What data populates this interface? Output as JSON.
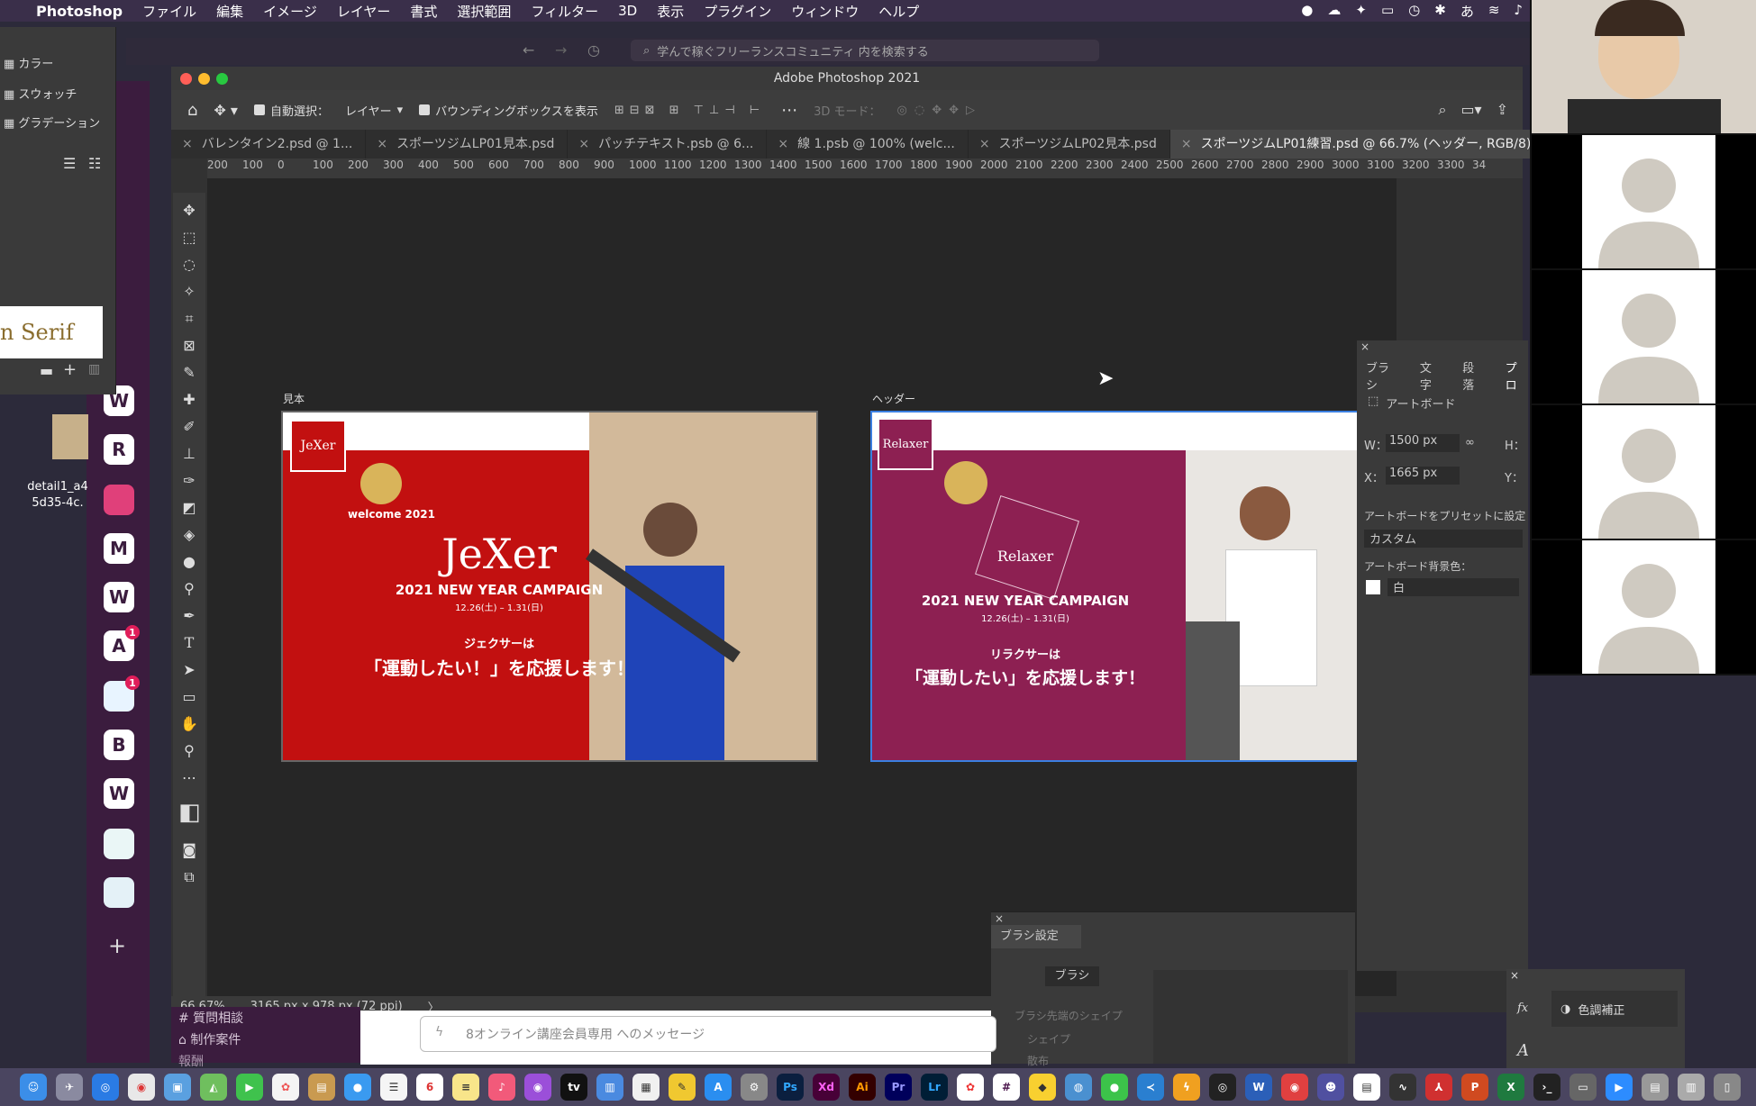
{
  "menubar": {
    "app": "Photoshop",
    "items": [
      "ファイル",
      "編集",
      "イメージ",
      "レイヤー",
      "書式",
      "選択範囲",
      "フィルター",
      "3D",
      "表示",
      "プラグイン",
      "ウィンドウ",
      "ヘルプ"
    ]
  },
  "search": {
    "placeholder": "学んで稼ぐフリーランスコミュニティ 内を検索する"
  },
  "swatches": {
    "items": [
      "カラー",
      "スウォッチ",
      "グラデーション"
    ],
    "font_preview": "n Serif"
  },
  "desktop": {
    "file_label_1": "detail1_a4",
    "file_label_2": "5d35-4c."
  },
  "slack": {
    "workspaces": [
      {
        "letter": "W",
        "badge": ""
      },
      {
        "letter": "R",
        "badge": ""
      },
      {
        "letter": "",
        "badge": ""
      },
      {
        "letter": "M",
        "badge": ""
      },
      {
        "letter": "W",
        "badge": ""
      },
      {
        "letter": "A",
        "badge": "1"
      },
      {
        "letter": "",
        "badge": "1"
      },
      {
        "letter": "B",
        "badge": ""
      },
      {
        "letter": "W",
        "badge": ""
      },
      {
        "letter": "",
        "badge": ""
      },
      {
        "letter": "",
        "badge": ""
      }
    ],
    "add": "+",
    "channel_1": "# 質問相談",
    "channel_2": "制作案件",
    "channel_3": "報酬",
    "message_placeholder": "8オンライン講座会員専用 へのメッセージ"
  },
  "photoshop": {
    "title": "Adobe Photoshop 2021",
    "options": {
      "auto_select": "自動選択：",
      "layer": "レイヤー",
      "bounding_box": "バウンディングボックスを表示",
      "mode_3d": "3D モード："
    },
    "tabs": [
      "バレンタイン2.psd @ 1...",
      "スポーツジムLP01見本.psd",
      "パッチテキスト.psb @ 6...",
      "線 1.psb @ 100% (welc...",
      "スポーツジムLP02見本.psd",
      "スポーツジムLP01練習.psd @ 66.7% (ヘッダー, RGB/8)"
    ],
    "ruler": [
      "200",
      "100",
      "0",
      "100",
      "200",
      "300",
      "400",
      "500",
      "600",
      "700",
      "800",
      "900",
      "1000",
      "1100",
      "1200",
      "1300",
      "1400",
      "1500",
      "1600",
      "1700",
      "1800",
      "1900",
      "2000",
      "2100",
      "2200",
      "2300",
      "2400",
      "2500",
      "2600",
      "2700",
      "2800",
      "2900",
      "3000",
      "3100",
      "3200",
      "3300",
      "34"
    ],
    "status": {
      "zoom": "66.67%",
      "doc": "3165 px x 978 px (72 ppi)",
      "arrow": "〉"
    },
    "artboard_1": {
      "label": "見本",
      "logo": "JeXer",
      "badge_text": "welcome 2021",
      "brand": "JeXer",
      "campaign": "2021 NEW YEAR CAMPAIGN",
      "dates": "12.26(土) – 1.31(日)",
      "subtitle": "ジェクサーは",
      "headline": "「運動したい！」を応援します！"
    },
    "artboard_2": {
      "label": "ヘッダー",
      "logo": "Relaxer",
      "brand": "Relaxer",
      "campaign": "2021 NEW YEAR CAMPAIGN",
      "dates": "12.26(土) – 1.31(日)",
      "subtitle": "リラクサーは",
      "headline": "「運動したい」を応援します！"
    },
    "properties": {
      "tabs": [
        "ブラシ",
        "文字",
        "段落",
        "プロ"
      ],
      "type": "アートボード",
      "w_label": "W：",
      "w_value": "1500 px",
      "h_label": "H：",
      "x_label": "X：",
      "x_value": "1665 px",
      "y_label": "Y：",
      "preset_label": "アートボードをプリセットに設定",
      "preset_value": "カスタム",
      "bg_label": "アートボード背景色：",
      "bg_value": "白"
    },
    "brush_panel": {
      "title": "ブラシ設定",
      "brush_button": "ブラシ",
      "tip_shape": "ブラシ先端のシェイプ",
      "shape": "シェイプ",
      "scatter": "散布"
    },
    "adjust_panel": {
      "label": "色調補正"
    }
  },
  "colors": {
    "jexer_red": "#c21010",
    "relaxer_purple": "#8d2052",
    "selection_blue": "#3b7fe0"
  }
}
